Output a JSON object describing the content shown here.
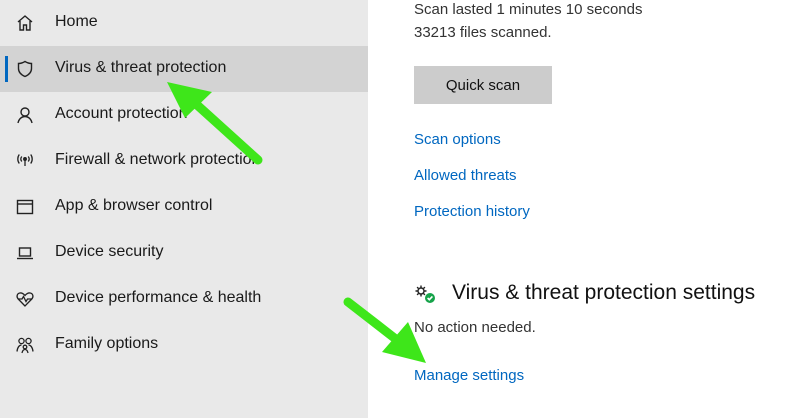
{
  "sidebar": {
    "items": [
      {
        "label": "Home",
        "icon": "home-icon"
      },
      {
        "label": "Virus & threat protection",
        "icon": "shield-icon",
        "selected": true
      },
      {
        "label": "Account protection",
        "icon": "person-icon"
      },
      {
        "label": "Firewall & network protection",
        "icon": "wifi-antenna-icon"
      },
      {
        "label": "App & browser control",
        "icon": "browser-window-icon"
      },
      {
        "label": "Device security",
        "icon": "laptop-icon"
      },
      {
        "label": "Device performance & health",
        "icon": "heart-pulse-icon"
      },
      {
        "label": "Family options",
        "icon": "family-icon"
      }
    ]
  },
  "main": {
    "scan_duration": "Scan lasted 1 minutes 10 seconds",
    "files_scanned": "33213 files scanned.",
    "quick_scan_label": "Quick scan",
    "links": {
      "scan_options": "Scan options",
      "allowed_threats": "Allowed threats",
      "protection_history": "Protection history"
    },
    "settings_section": {
      "title": "Virus & threat protection settings",
      "status": "No action needed.",
      "manage_link": "Manage settings",
      "icon": "gear-check-icon"
    }
  },
  "colors": {
    "accent": "#0067c0",
    "sidebar_bg": "#e9e9e9",
    "selected_bg": "#d3d3d3",
    "annotation_arrow": "#3ee61a"
  }
}
